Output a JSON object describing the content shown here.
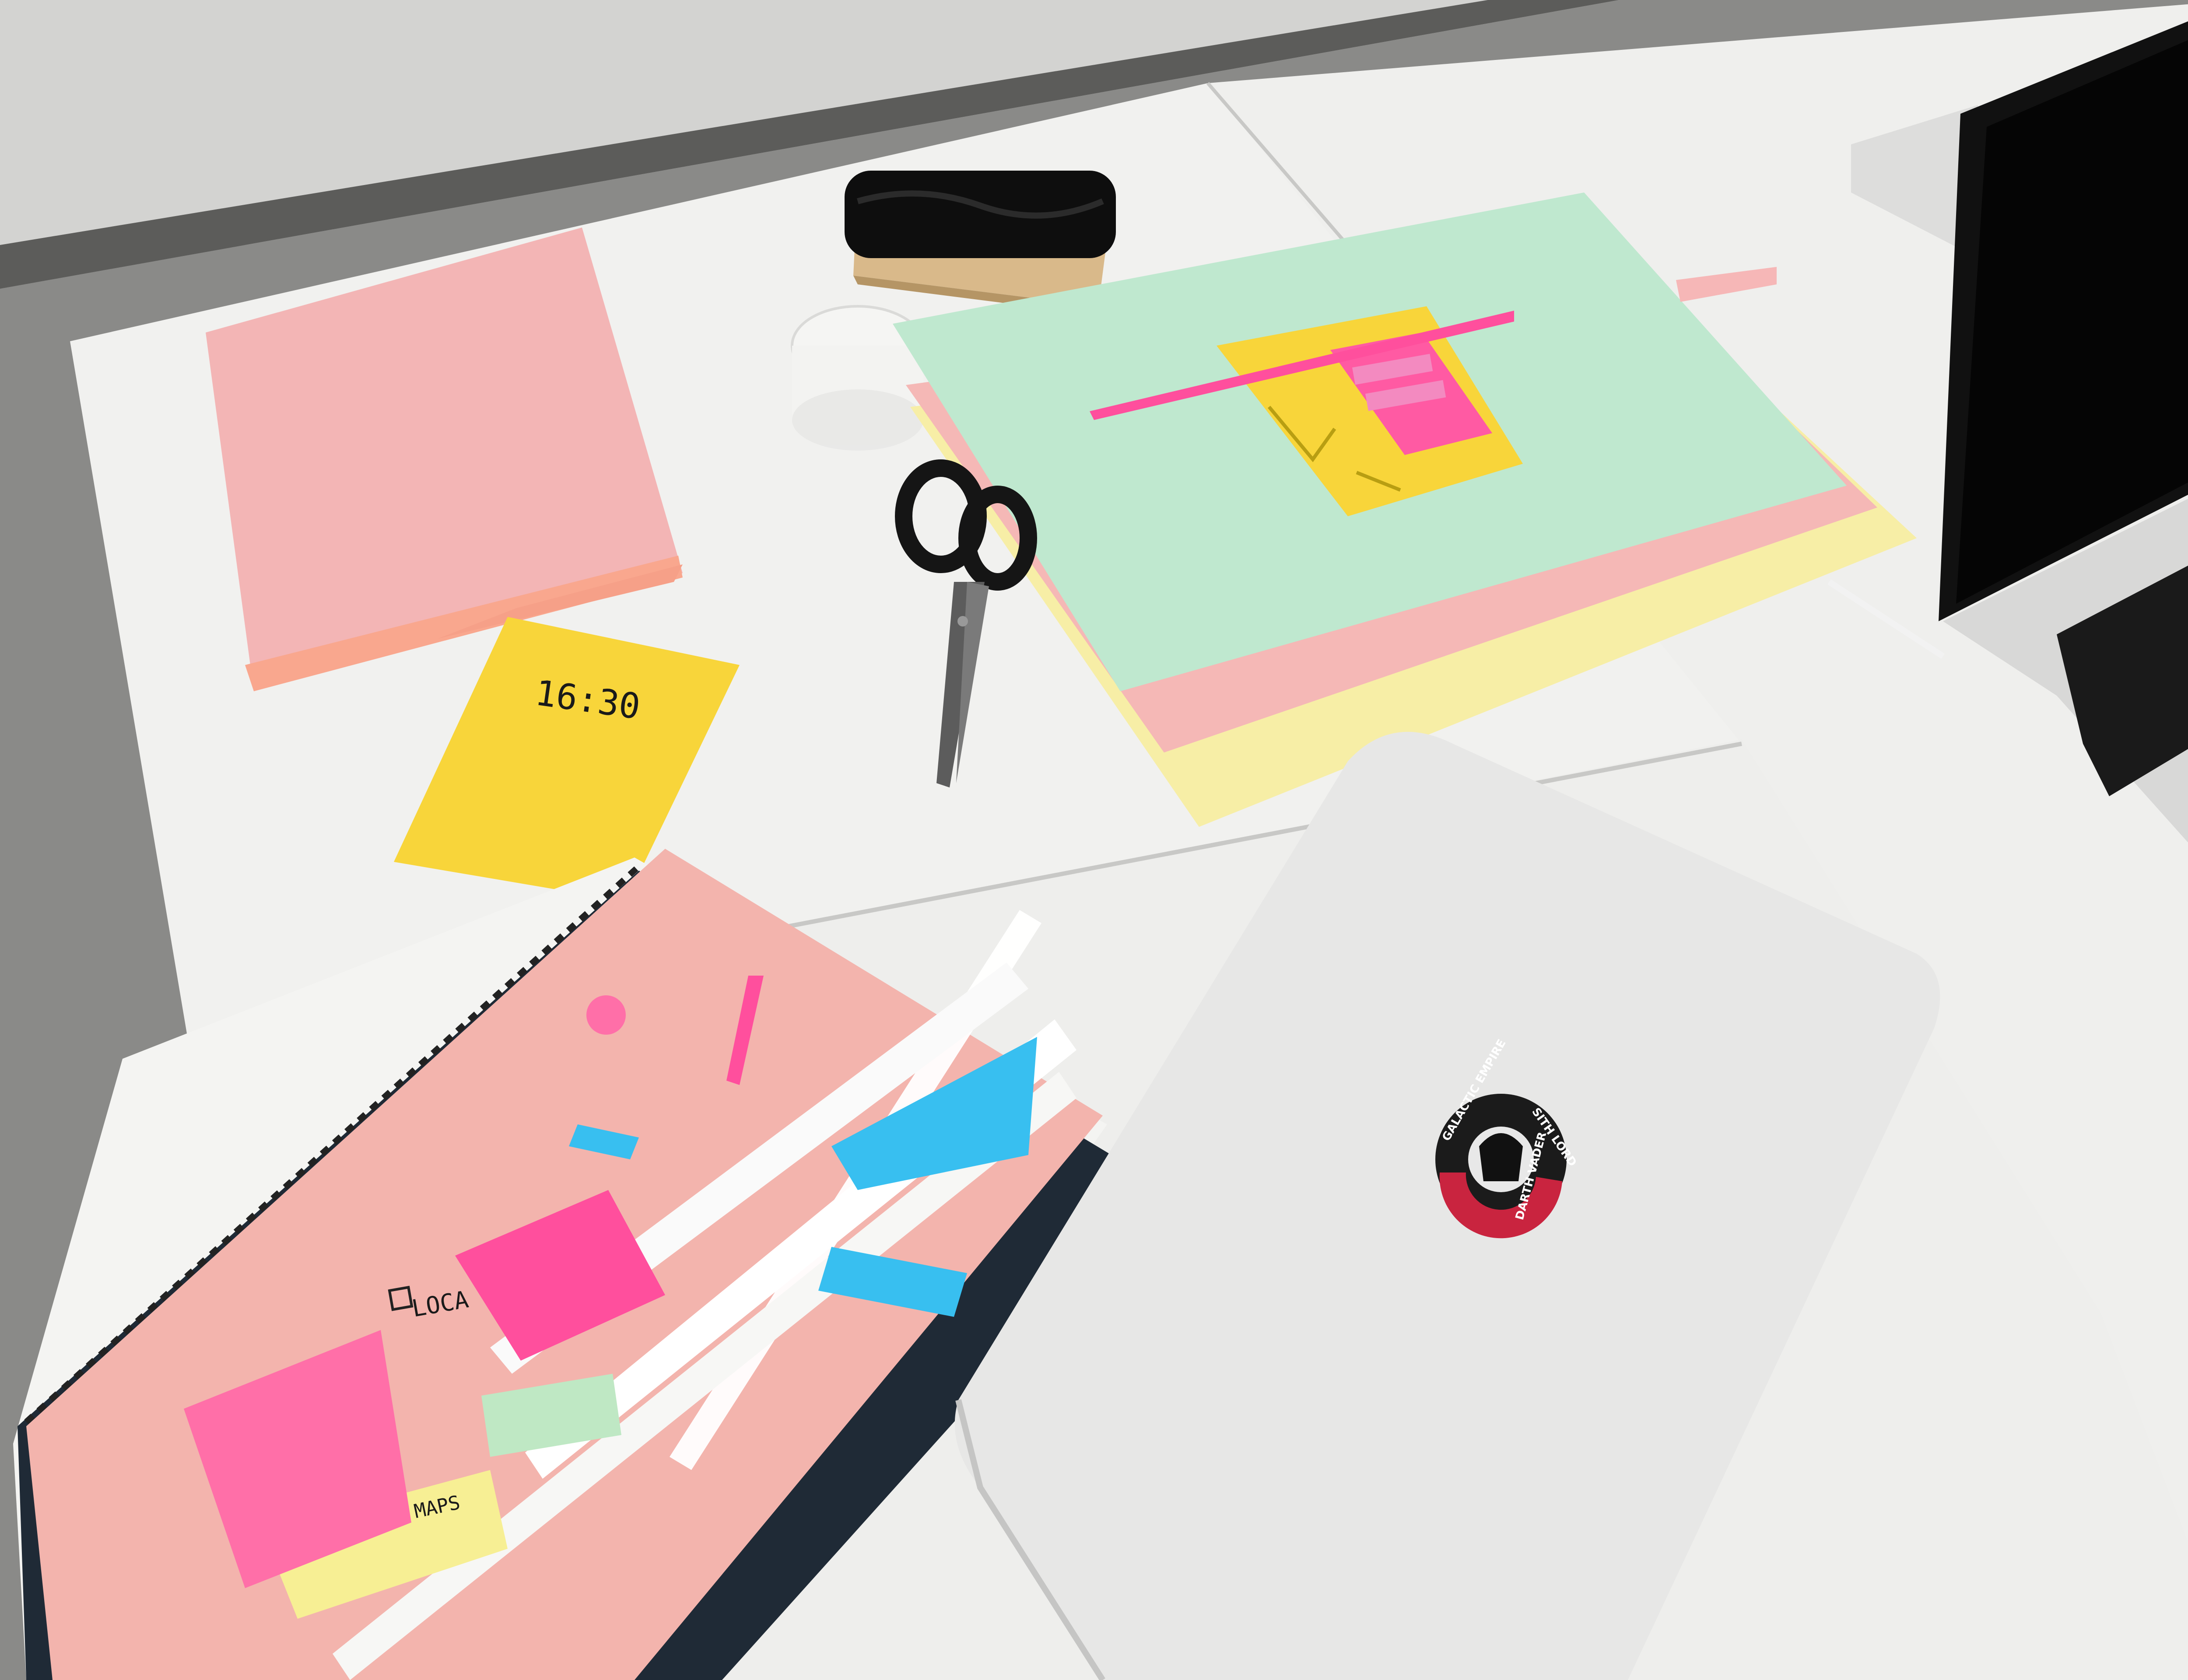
{
  "photo": {
    "clock_note_text": "16:30",
    "sticker": {
      "top_text": "GALACTIC EMPIRE",
      "side_text": "SITH LORD",
      "bottom_text": "DARTH VADER"
    },
    "prototype_labels": {
      "checkbox_label": "LOCA",
      "map_note": "MAPS"
    },
    "colors": {
      "table": "#f1f1ef",
      "floor": "#8a8a88",
      "wall": "#d2d2d0",
      "paper_pink": "#f6b9b9",
      "paper_green": "#bfe8cf",
      "paper_yellow": "#f7eea6",
      "sticky_yellow": "#f8d53a",
      "neon_pink": "#ff4f9d",
      "cyan_note": "#38bff0",
      "laptop_silver": "#e6e6e5"
    },
    "objects": [
      "whiteboard-eraser",
      "glass-jar",
      "scissors",
      "paper-stack",
      "paper-phone-prototype",
      "spiral-notebook",
      "closed-laptop",
      "open-laptop"
    ]
  }
}
